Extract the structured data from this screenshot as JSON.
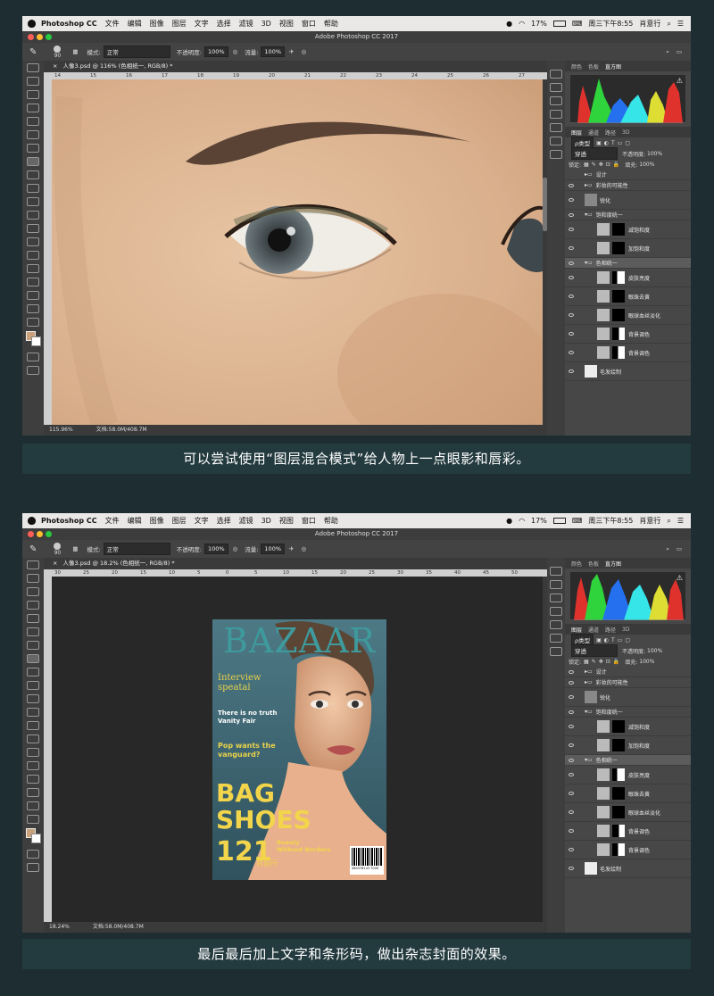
{
  "menubar": {
    "app": "Photoshop CC",
    "items": [
      "文件",
      "编辑",
      "图像",
      "图层",
      "文字",
      "选择",
      "滤镜",
      "3D",
      "视图",
      "窗口",
      "帮助"
    ],
    "battery": "17%",
    "clock": "周三下午8:55",
    "user": "肖意行"
  },
  "window_title": "Adobe Photoshop CC 2017",
  "options": {
    "brush_size": "90",
    "mode_label": "模式:",
    "mode_value": "正常",
    "opacity_label": "不透明度:",
    "opacity_value": "100%",
    "flow_label": "流量:",
    "flow_value": "100%"
  },
  "shot1": {
    "tab": "人像3.psd @ 116% (色相统一, RGB/8) *",
    "ruler_marks": [
      "14",
      "15",
      "16",
      "17",
      "18",
      "19",
      "20",
      "21",
      "22",
      "23",
      "24",
      "25",
      "26",
      "27"
    ],
    "zoom": "115.96%",
    "doc_size": "文档:58.0M/408.7M"
  },
  "shot2": {
    "tab": "人像3.psd @ 18.2% (色相统一, RGB/8) *",
    "ruler_marks": [
      "30",
      "25",
      "20",
      "15",
      "10",
      "5",
      "0",
      "5",
      "10",
      "15",
      "20",
      "25",
      "30",
      "35",
      "40",
      "45",
      "50"
    ],
    "zoom": "18.24%",
    "doc_size": "文档:58.0M/408.7M"
  },
  "panels": {
    "tabs_top": [
      "颜色",
      "色板",
      "直方图"
    ],
    "tabs_layers": [
      "图层",
      "通道",
      "路径",
      "3D"
    ],
    "kind_label": "ρ类型",
    "blend_mode": "穿透",
    "opacity_label": "不透明度:",
    "opacity_value": "100%",
    "lock_label": "锁定:",
    "fill_label": "填充:",
    "fill_value": "100%",
    "layers": [
      {
        "name": "设计"
      },
      {
        "name": "彩妆的可能性"
      },
      {
        "name": "锐化"
      },
      {
        "name": "饱和度统一"
      },
      {
        "name": "减饱和度"
      },
      {
        "name": "加饱和度"
      },
      {
        "name": "色相统一"
      },
      {
        "name": "皮肤亮度"
      },
      {
        "name": "眼珠去黄"
      },
      {
        "name": "眼球血丝淡化"
      },
      {
        "name": "背景调色"
      },
      {
        "name": "背景调色"
      },
      {
        "name": "毛发绘制"
      }
    ]
  },
  "magazine": {
    "masthead": "BAZAAR",
    "line1": "Interview",
    "line2": "speatal",
    "line3": "There is no truth",
    "line4": "Vanity Fair",
    "line5": "Pop wants the",
    "line6": "vanguard?",
    "big1": "BAG",
    "big2": "SHOES",
    "number": "121",
    "num_line1": "Beauty",
    "num_line2": "Without Borders",
    "author": "肖意行",
    "barcode_text": "080378143 7049"
  },
  "captions": {
    "top": "可以尝试使用“图层混合模式”给人物上一点眼影和唇彩。",
    "bottom": "最后最后加上文字和条形码，做出杂志封面的效果。"
  }
}
